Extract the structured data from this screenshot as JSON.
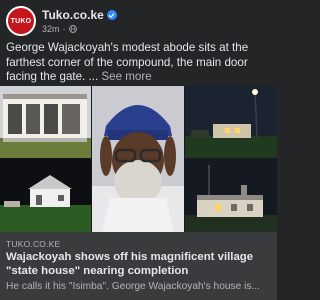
{
  "header": {
    "avatar_text": "TUKO",
    "page_name": "Tuko.co.ke",
    "time": "32m",
    "separator": "·"
  },
  "caption": {
    "text": "George Wajackoyah's modest abode sits at the farthest corner of the compound, the main door facing the gate. ...",
    "see_more": "See more"
  },
  "photos": [
    {
      "icon": "house-photo",
      "subject": "walled house with windows"
    },
    {
      "icon": "portrait-photo",
      "subject": "man in blue hat with glasses"
    },
    {
      "icon": "night-house-photo",
      "subject": "house at night with street light"
    },
    {
      "icon": "house-photo",
      "subject": "white house in yard"
    },
    {
      "icon": "night-house-photo",
      "subject": "house in evening"
    }
  ],
  "link_preview": {
    "domain": "TUKO.CO.KE",
    "headline": "Wajackoyah shows off his magnificent village \"state house\" nearing completion",
    "description": "He calls it his \"Isimba\". George Wajackoyah's house is..."
  },
  "colors": {
    "background": "#242526",
    "text": "#e4e6eb",
    "secondary_text": "#b0b3b8",
    "verified": "#2d88ff",
    "brand": "#c4161c",
    "link_card": "#3a3b3c"
  }
}
